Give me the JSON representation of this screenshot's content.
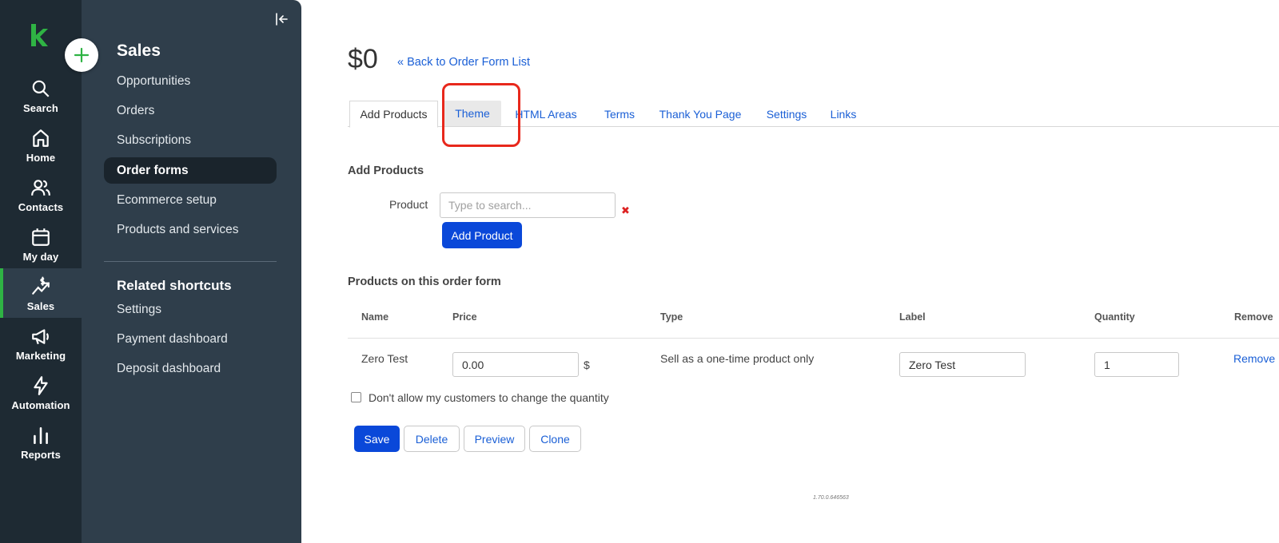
{
  "rail": {
    "items": [
      {
        "label": "Search",
        "icon": "search-icon"
      },
      {
        "label": "Home",
        "icon": "home-icon"
      },
      {
        "label": "Contacts",
        "icon": "contacts-icon"
      },
      {
        "label": "My day",
        "icon": "calendar-icon"
      },
      {
        "label": "Sales",
        "icon": "sales-icon",
        "active": true
      },
      {
        "label": "Marketing",
        "icon": "megaphone-icon"
      },
      {
        "label": "Automation",
        "icon": "lightning-icon"
      },
      {
        "label": "Reports",
        "icon": "bar-chart-icon"
      }
    ],
    "brand_color": "#2fb344"
  },
  "sidebar": {
    "title": "Sales",
    "links": [
      {
        "label": "Opportunities"
      },
      {
        "label": "Orders"
      },
      {
        "label": "Subscriptions"
      },
      {
        "label": "Order forms",
        "active": true
      },
      {
        "label": "Ecommerce setup"
      },
      {
        "label": "Products and services"
      }
    ],
    "shortcuts_title": "Related shortcuts",
    "shortcuts": [
      {
        "label": "Settings"
      },
      {
        "label": "Payment dashboard"
      },
      {
        "label": "Deposit dashboard"
      }
    ]
  },
  "header": {
    "amount": "$0",
    "back_link": "« Back to Order Form List"
  },
  "tabs": [
    {
      "label": "Add Products",
      "active": true
    },
    {
      "label": "Theme",
      "highlighted": true
    },
    {
      "label": "HTML Areas"
    },
    {
      "label": "Terms"
    },
    {
      "label": "Thank You Page"
    },
    {
      "label": "Settings"
    },
    {
      "label": "Links"
    }
  ],
  "add_products": {
    "title": "Add Products",
    "product_label": "Product",
    "search_placeholder": "Type to search...",
    "clear_glyph": "✖",
    "add_button": "Add Product"
  },
  "products_table": {
    "title": "Products on this order form",
    "columns": [
      "Name",
      "Price",
      "Type",
      "Label",
      "Quantity",
      "Remove"
    ],
    "rows": [
      {
        "name": "Zero Test",
        "price": "0.00",
        "currency": "$",
        "type": "Sell as a one-time product only",
        "label": "Zero Test",
        "quantity": "1",
        "remove": "Remove"
      }
    ]
  },
  "quantity_lock_label": "Don't allow my customers to change the quantity",
  "actions": {
    "save": "Save",
    "delete": "Delete",
    "preview": "Preview",
    "clone": "Clone"
  },
  "version": "1.70.0.646563",
  "colors": {
    "primary_button": "#0a48d9",
    "link": "#1a5fd6",
    "highlight_box": "#e8281c",
    "sidebar_bg": "#2f3e4b",
    "rail_bg": "#1e2a33"
  }
}
